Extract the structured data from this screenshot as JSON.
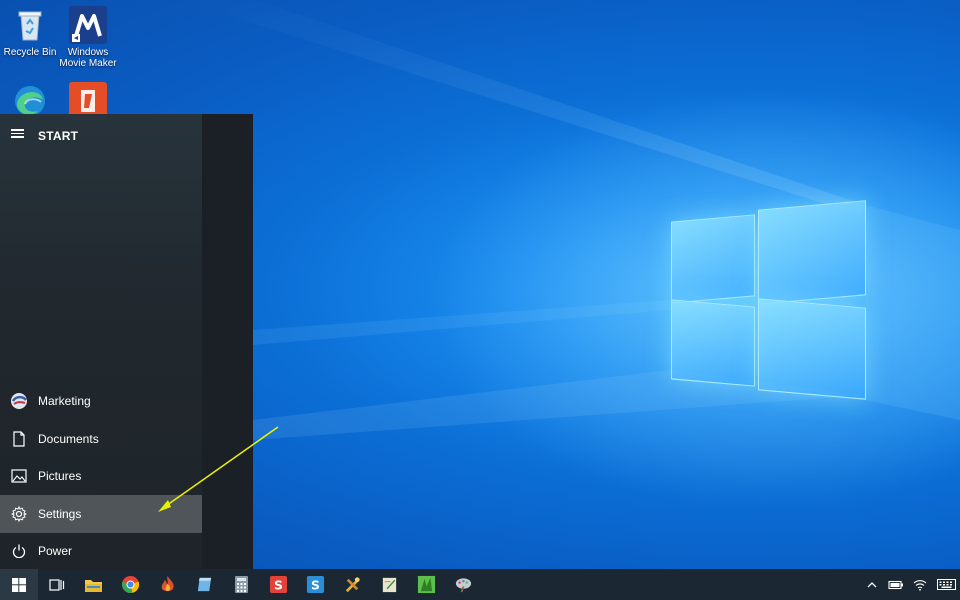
{
  "desktop": {
    "icons": [
      {
        "label": "Recycle Bin",
        "icon": "recycle-bin-icon"
      },
      {
        "label": "Windows Movie Maker",
        "icon": "movie-maker-icon"
      },
      {
        "label": "",
        "icon": "edge-icon"
      },
      {
        "label": "",
        "icon": "office-icon"
      }
    ],
    "wallpaper": "windows-10-hero"
  },
  "start_menu": {
    "title": "START",
    "items": [
      {
        "label": "Marketing",
        "icon": "user-avatar-icon"
      },
      {
        "label": "Documents",
        "icon": "document-icon"
      },
      {
        "label": "Pictures",
        "icon": "pictures-icon"
      },
      {
        "label": "Settings",
        "icon": "gear-icon",
        "highlighted": true
      },
      {
        "label": "Power",
        "icon": "power-icon"
      }
    ]
  },
  "taskbar": {
    "apps": [
      {
        "name": "task-view",
        "color": "#ffffff"
      },
      {
        "name": "file-explorer",
        "color": "#f2c94c"
      },
      {
        "name": "chrome",
        "color": "#ea4335"
      },
      {
        "name": "app-flame",
        "color": "#d9532c"
      },
      {
        "name": "app-blue-book",
        "color": "#6fb6e6"
      },
      {
        "name": "calculator",
        "color": "#8a9aa8"
      },
      {
        "name": "app-red-s",
        "color": "#e2423a"
      },
      {
        "name": "app-blue-s",
        "color": "#2a8fd8"
      },
      {
        "name": "app-tools",
        "color": "#e0b24a"
      },
      {
        "name": "app-notepad",
        "color": "#e9e6cf"
      },
      {
        "name": "app-green",
        "color": "#5bbf4a"
      },
      {
        "name": "app-paint",
        "color": "#c4cdd6"
      }
    ],
    "tray": [
      "chevron-up-icon",
      "battery-icon",
      "wifi-icon",
      "keyboard-icon"
    ]
  },
  "colors": {
    "accent": "#0a78e0",
    "annotation_arrow": "#e8f000"
  }
}
